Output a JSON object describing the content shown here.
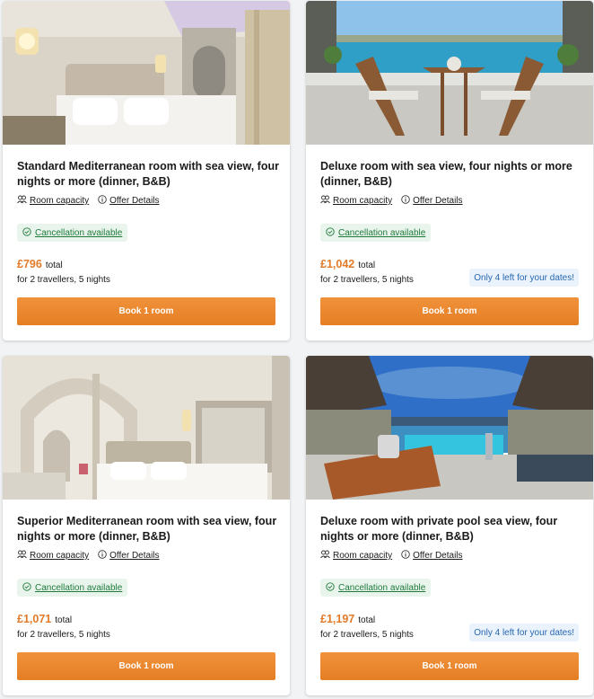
{
  "links": {
    "room_capacity": "Room capacity",
    "offer_details": "Offer Details",
    "cancellation": "Cancellation available"
  },
  "colors": {
    "accent": "#e57e25",
    "price": "#e37a28",
    "cancellation_bg": "#e9f5ec",
    "cancellation_text": "#1f7a3c",
    "scarcity_bg": "#eaf3fb",
    "scarcity_text": "#2867b2"
  },
  "rooms": [
    {
      "photo": "standard-mediterranean-room-photo",
      "title": "Standard Mediterranean room with sea view, four nights or more (dinner, B&B)",
      "price": "£796",
      "price_suffix": "total",
      "travellers": "for 2 travellers, 5 nights",
      "scarcity": "",
      "book_label": "Book 1 room"
    },
    {
      "photo": "deluxe-room-balcony-photo",
      "title": "Deluxe room with sea view, four nights or more (dinner, B&B)",
      "price": "£1,042",
      "price_suffix": "total",
      "travellers": "for 2 travellers, 5 nights",
      "scarcity": "Only 4 left for your dates!",
      "book_label": "Book 1 room"
    },
    {
      "photo": "superior-mediterranean-room-photo",
      "title": "Superior Mediterranean room with sea view, four nights or more (dinner, B&B)",
      "price": "£1,071",
      "price_suffix": "total",
      "travellers": "for 2 travellers, 5 nights",
      "scarcity": "",
      "book_label": "Book 1 room"
    },
    {
      "photo": "deluxe-private-pool-photo",
      "title": "Deluxe room with private pool sea view, four nights or more (dinner, B&B)",
      "price": "£1,197",
      "price_suffix": "total",
      "travellers": "for 2 travellers, 5 nights",
      "scarcity": "Only 4 left for your dates!",
      "book_label": "Book 1 room"
    }
  ]
}
